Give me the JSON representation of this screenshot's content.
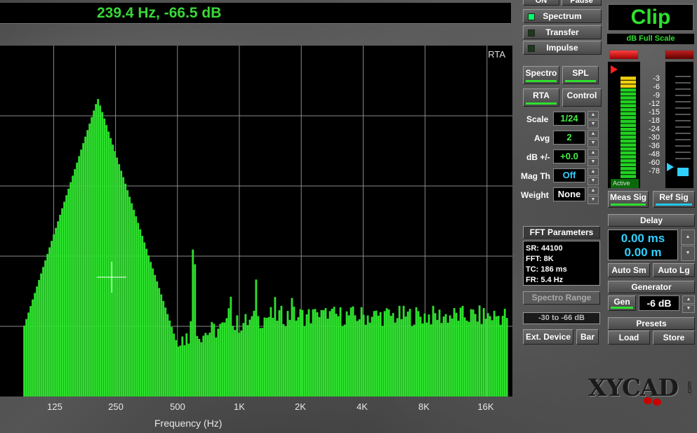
{
  "readout": "239.4 Hz, -66.5 dB",
  "top_buttons": {
    "on": "ON",
    "pause": "Pause"
  },
  "modes": [
    {
      "label": "Spectrum",
      "active": true
    },
    {
      "label": "Transfer",
      "active": false
    },
    {
      "label": "Impulse",
      "active": false
    }
  ],
  "view_buttons": {
    "spectro": "Spectro",
    "spl": "SPL",
    "rta": "RTA",
    "control": "Control"
  },
  "settings": [
    {
      "label": "Scale",
      "value": "1/24"
    },
    {
      "label": "Avg",
      "value": "2"
    },
    {
      "label": "dB +/-",
      "value": "+0.0"
    },
    {
      "label": "Mag Th",
      "value": "Off"
    },
    {
      "label": "Weight",
      "value": "None"
    }
  ],
  "fft": {
    "title": "FFT Parameters",
    "sr": "SR: 44100",
    "fft": "FFT: 8K",
    "tc": "TC: 186 ms",
    "fr": "FR: 5.4 Hz"
  },
  "spectro_range": {
    "button": "Spectro Range",
    "value": "-30 to -66 dB"
  },
  "device": {
    "ext": "Ext. Device",
    "bar": "Bar"
  },
  "meter": {
    "clip": "Clip",
    "full_scale": "dB Full Scale",
    "active": "Active",
    "scale": [
      "-3",
      "-6",
      "-9",
      "-12",
      "-15",
      "-18",
      "-24",
      "-30",
      "-36",
      "-48",
      "-60",
      "-78"
    ],
    "meas_level_db": -3,
    "ref_level_db": -78
  },
  "signals": {
    "meas": "Meas Sig",
    "ref": "Ref Sig"
  },
  "delay": {
    "title": "Delay",
    "ms": "0.00 ms",
    "m": "0.00 m",
    "auto_sm": "Auto Sm",
    "auto_lg": "Auto Lg"
  },
  "generator": {
    "title": "Generator",
    "gen": "Gen",
    "level": "-6 dB"
  },
  "presets": {
    "title": "Presets",
    "load": "Load",
    "store": "Store"
  },
  "logo": {
    "brand": "XYCAD",
    "suffix": ".com"
  },
  "colors": {
    "trace": "#2ee02e",
    "background": "#000000",
    "grid": "#8a8a8a",
    "accent_cyan": "#30d0ff"
  },
  "chart_data": {
    "type": "bar",
    "title": "RTA",
    "xlabel": "Frequency (Hz)",
    "x_scale": "log",
    "x_ticks": [
      "125",
      "250",
      "500",
      "1K",
      "2K",
      "4K",
      "8K",
      "16K"
    ],
    "y_range_db": [
      -100,
      0
    ],
    "grid": true,
    "peaks_hz": [
      205,
      395,
      600,
      900,
      1200,
      1500,
      1800,
      2100,
      2400,
      2700,
      3000,
      3300,
      3600,
      3900
    ],
    "peak_levels_db": [
      -15,
      -83,
      -50,
      -63,
      -62,
      -67,
      -71,
      -73,
      -73,
      -75,
      -76,
      -77,
      -78,
      -79
    ]
  }
}
